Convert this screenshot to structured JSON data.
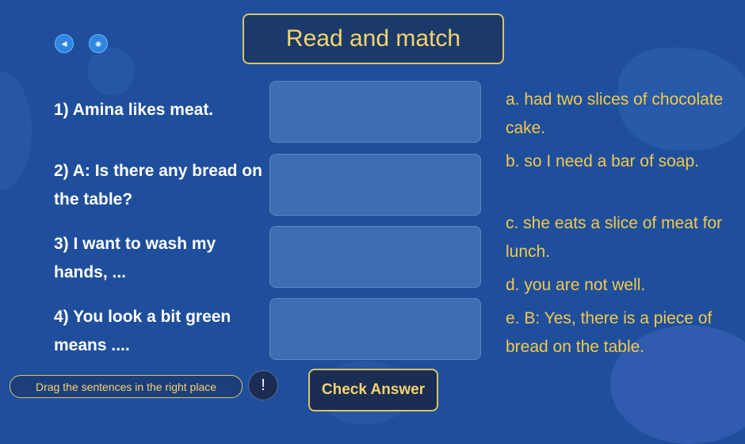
{
  "title": "Read and match",
  "controls": {
    "back_icon": "◀",
    "sound_icon": "◉"
  },
  "questions": [
    {
      "text": "1) Amina likes meat."
    },
    {
      "text": "2) A: Is there any bread on the table?"
    },
    {
      "text": "3) I want to wash my hands, ..."
    },
    {
      "text": "4) You look a bit green means ...."
    }
  ],
  "answers": [
    {
      "text": "a. had two slices of chocolate cake."
    },
    {
      "text": "b. so I need a bar of soap."
    },
    {
      "text": "c. she eats a slice of meat for lunch."
    },
    {
      "text": "d. you are not well."
    },
    {
      "text": "e. B: Yes, there is a piece of bread on the table."
    }
  ],
  "footer": {
    "hint": "Drag the sentences in the right place",
    "info_icon": "!",
    "check_label": "Check Answer"
  }
}
